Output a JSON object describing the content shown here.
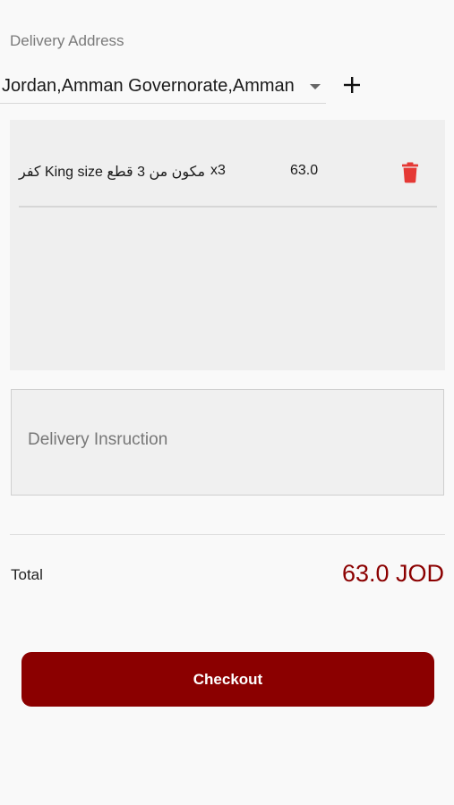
{
  "address": {
    "label": "Delivery Address",
    "selected": "Jordan,Amman Governorate,Amman",
    "dropdown_icon": "chevron-down-icon",
    "add_icon": "plus-icon"
  },
  "cart": {
    "items": [
      {
        "name": "كفر King size  مكون من 3 قطع",
        "quantity": "x3",
        "price": "63.0",
        "delete_icon": "trash-icon"
      }
    ]
  },
  "instructions": {
    "placeholder": "Delivery Insruction",
    "value": ""
  },
  "total": {
    "label": "Total",
    "value": "63.0 JOD"
  },
  "checkout": {
    "label": "Checkout"
  },
  "colors": {
    "accent": "#8B0000",
    "delete": "#E53935",
    "panel": "#EFEFEF",
    "background": "#F9F9F9"
  }
}
